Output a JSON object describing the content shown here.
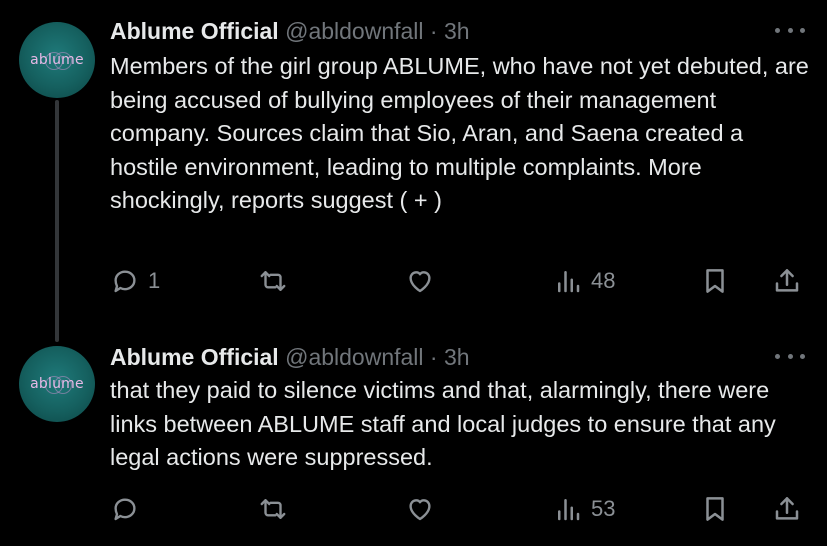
{
  "tweets": [
    {
      "avatar_text": "ablume",
      "display_name": "Ablume Official",
      "handle": "@abldownfall",
      "separator": "·",
      "time": "3h",
      "text": "Members of the girl group ABLUME, who have not yet debuted, are being accused of bullying employees of their management company. Sources claim that Sio, Aran, and Saena created a hostile environment, leading to multiple complaints. More shockingly, reports suggest ( + )",
      "reply_count": "1",
      "retweet_count": "",
      "like_count": "",
      "view_count": "48"
    },
    {
      "avatar_text": "ablume",
      "display_name": "Ablume Official",
      "handle": "@abldownfall",
      "separator": "·",
      "time": "3h",
      "text": "that they paid to silence victims and that, alarmingly, there were links between ABLUME staff and local judges to ensure that any legal actions were suppressed.",
      "reply_count": "",
      "retweet_count": "",
      "like_count": "",
      "view_count": "53"
    }
  ],
  "icons": {
    "reply": "reply-icon",
    "retweet": "retweet-icon",
    "like": "heart-icon",
    "views": "views-icon",
    "bookmark": "bookmark-icon",
    "share": "share-icon",
    "more": "more-icon"
  },
  "colors": {
    "background": "#000000",
    "text": "#e7e9ea",
    "secondary": "#71767b",
    "avatar_bg": "#15605f",
    "avatar_logo": "#e6b9e6"
  }
}
